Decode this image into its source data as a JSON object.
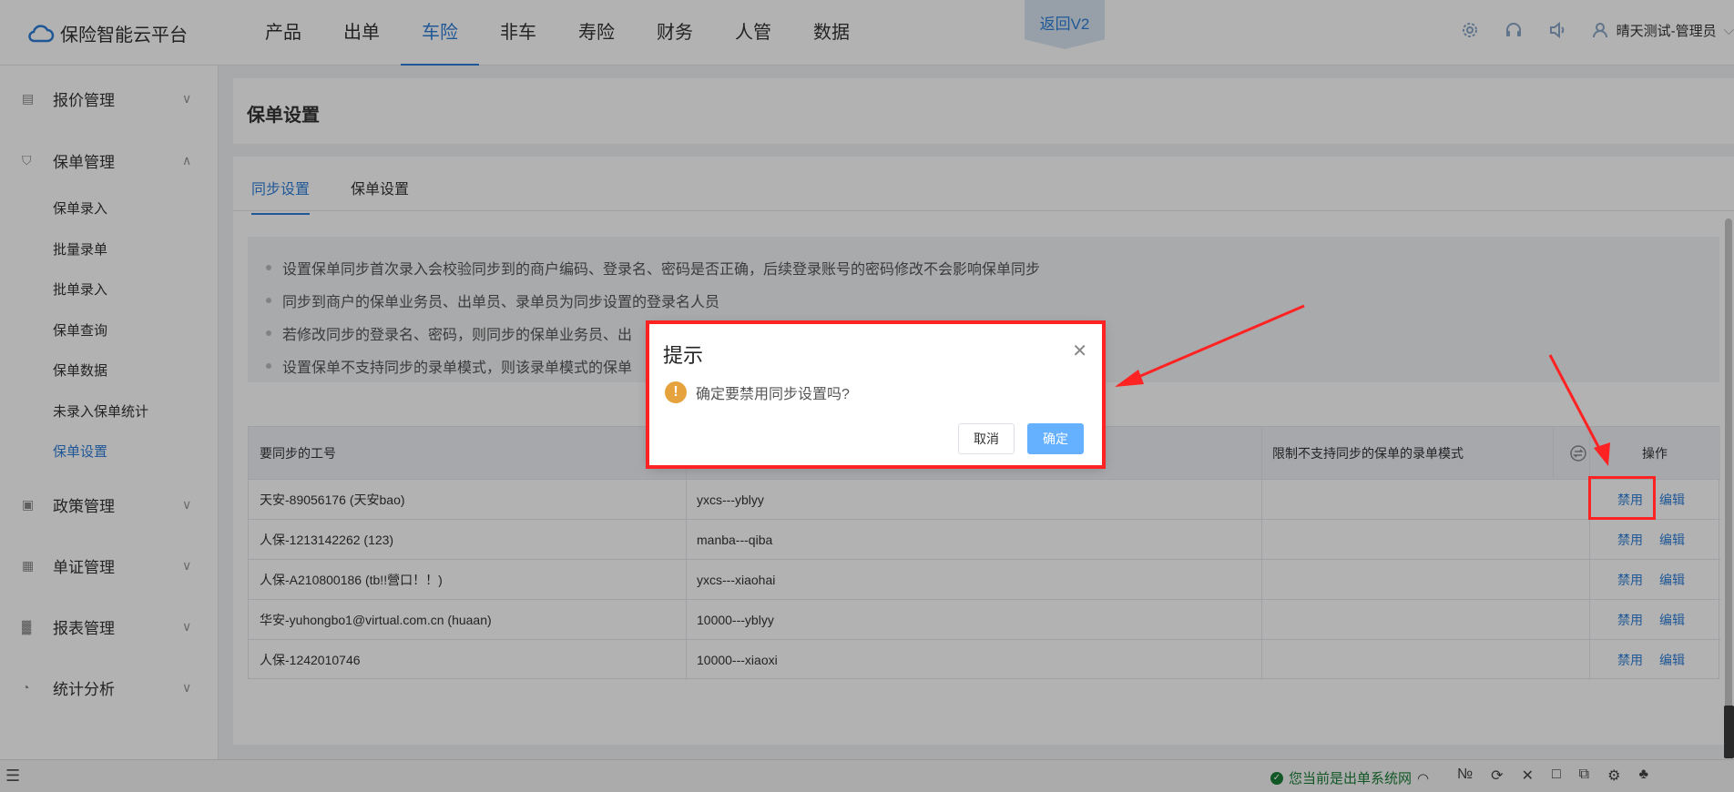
{
  "topbar": {
    "logo_text": "保险智能云平台",
    "nav": [
      "产品",
      "出单",
      "车险",
      "非车",
      "寿险",
      "财务",
      "人管",
      "数据"
    ],
    "active_nav": "车险",
    "back_v2": "返回V2",
    "user_name": "晴天测试-管理员",
    "icons": [
      "gear-icon",
      "headset-icon",
      "speaker-icon",
      "user-icon",
      "chevron-down-icon"
    ]
  },
  "sidebar": {
    "groups": {
      "quote": "报价管理",
      "policy": "保单管理",
      "policy_items": [
        "保单录入",
        "批量录单",
        "批单录入",
        "保单查询",
        "保单数据",
        "未录入保单统计",
        "保单设置"
      ],
      "active_item": "保单设置",
      "rules": "政策管理",
      "voucher": "单证管理",
      "report": "报表管理",
      "stats": "统计分析"
    }
  },
  "page": {
    "title": "保单设置",
    "tabs": [
      "同步设置",
      "保单设置"
    ],
    "active_tab": "同步设置",
    "notes": [
      "设置保单同步首次录入会校验同步到的商户编码、登录名、密码是否正确，后续登录账号的密码修改不会影响保单同步",
      "同步到商户的保单业务员、出单员、录单员为同步设置的登录名人员",
      "若修改同步的登录名、密码，则同步的保单业务员、出",
      "设置保单不支持同步的录单模式，则该录单模式的保单"
    ]
  },
  "table": {
    "headers": [
      "要同步的工号",
      "",
      "限制不支持同步的保单的录单模式",
      "操作"
    ],
    "rows": [
      [
        "天安-89056176 (天安bao)",
        "yxcs---yblyy",
        ""
      ],
      [
        "人保-1213142262 (123)",
        "manba---qiba",
        ""
      ],
      [
        "人保-A210800186 (tb!!營口！！)",
        "yxcs---xiaohai",
        ""
      ],
      [
        "华安-yuhongbo1@virtual.com.cn (huaan)",
        "10000---yblyy",
        ""
      ],
      [
        "人保-1242010746",
        "10000---xiaoxi",
        ""
      ]
    ],
    "action_disable": "禁用",
    "action_edit": "编辑"
  },
  "dialog": {
    "title": "提示",
    "message": "确定要禁用同步设置吗?",
    "cancel": "取消",
    "confirm": "确定"
  },
  "bottombar": {
    "status": "您当前是出单系统网",
    "icons": [
      "menu-icon",
      "wifi-icon",
      "number-icon",
      "refresh-icon",
      "close-icon",
      "trash-icon",
      "copy-icon",
      "gear-icon",
      "paw-icon"
    ]
  },
  "colors": {
    "accent": "#2f7ed8",
    "annotation_red": "#ff2222",
    "warning": "#e6a23c"
  }
}
